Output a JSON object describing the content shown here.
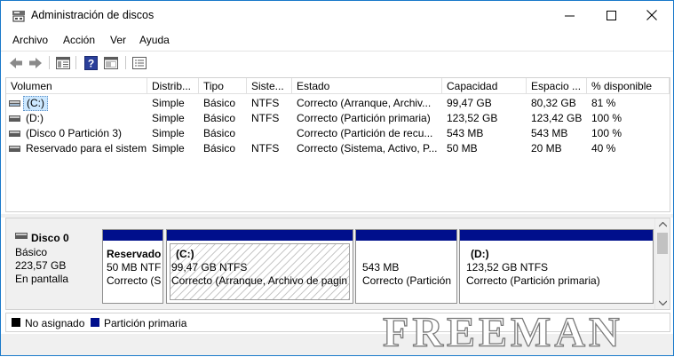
{
  "window": {
    "title": "Administración de discos",
    "icon": "disk-management-icon"
  },
  "menu": [
    "Archivo",
    "Acción",
    "Ver",
    "Ayuda"
  ],
  "toolbar_icons": [
    "back-arrow-icon",
    "forward-arrow-icon",
    "console-tree-icon",
    "help-icon",
    "properties-icon",
    "action-pane-icon"
  ],
  "columns": [
    "Volumen",
    "Distrib...",
    "Tipo",
    "Siste...",
    "Estado",
    "Capacidad",
    "Espacio ...",
    "% disponible"
  ],
  "volumes": [
    {
      "name": "(C:)",
      "layout": "Simple",
      "type": "Básico",
      "fs": "NTFS",
      "status": "Correcto (Arranque, Archiv...",
      "capacity": "99,47 GB",
      "free": "80,32 GB",
      "pct": "81 %",
      "selected": true
    },
    {
      "name": "(D:)",
      "layout": "Simple",
      "type": "Básico",
      "fs": "NTFS",
      "status": "Correcto (Partición primaria)",
      "capacity": "123,52 GB",
      "free": "123,42 GB",
      "pct": "100 %",
      "selected": false
    },
    {
      "name": "(Disco 0 Partición 3)",
      "layout": "Simple",
      "type": "Básico",
      "fs": "",
      "status": "Correcto (Partición de recu...",
      "capacity": "543 MB",
      "free": "543 MB",
      "pct": "100 %",
      "selected": false
    },
    {
      "name": "Reservado para el sistema",
      "layout": "Simple",
      "type": "Básico",
      "fs": "NTFS",
      "status": "Correcto (Sistema, Activo, P...",
      "capacity": "50 MB",
      "free": "20 MB",
      "pct": "40 %",
      "selected": false
    }
  ],
  "disk": {
    "name": "Disco 0",
    "type": "Básico",
    "size": "223,57 GB",
    "state": "En pantalla"
  },
  "partitions": [
    {
      "label": "Reservado",
      "size": "50 MB NTF",
      "status": "Correcto (S",
      "hatched": false
    },
    {
      "label": "(C:)",
      "size": "99,47 GB NTFS",
      "status": "Correcto (Arranque, Archivo de pagin",
      "hatched": true
    },
    {
      "label": "",
      "size": "543 MB",
      "status": "Correcto (Partición",
      "hatched": false
    },
    {
      "label": "(D:)",
      "size": "123,52 GB NTFS",
      "status": "Correcto (Partición primaria)",
      "hatched": false
    }
  ],
  "legend": [
    {
      "label": "No asignado",
      "color": "#000000"
    },
    {
      "label": "Partición primaria",
      "color": "#000f8c"
    }
  ],
  "watermark": "FREEMAN",
  "colors": {
    "primary_partition": "#000f8c",
    "selection": "#cce8ff",
    "window_border": "#1979ca"
  }
}
